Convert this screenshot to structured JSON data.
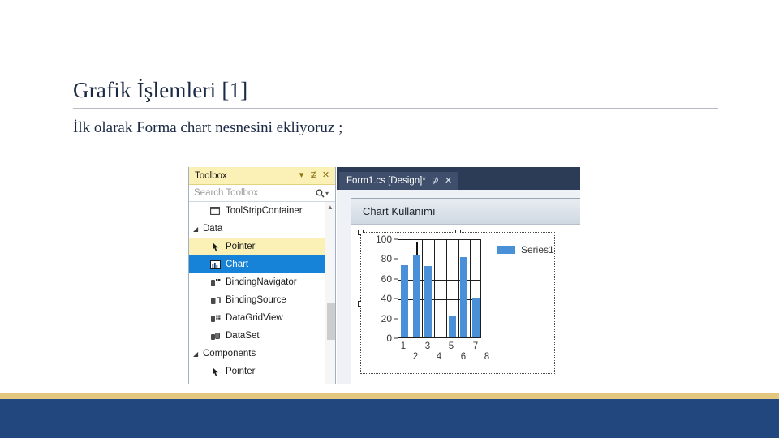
{
  "slide": {
    "title": "Grafik İşlemleri [1]",
    "subtitle": "İlk olarak Forma chart nesnesini ekliyoruz ;",
    "accent_gold": "#e3c77e",
    "accent_navy": "#22477f",
    "title_color": "#1b2a44"
  },
  "toolbox": {
    "title": "Toolbox",
    "header_icons": [
      {
        "name": "chevron-down-icon",
        "glyph": "▾"
      },
      {
        "name": "pin-icon",
        "glyph": "⊉"
      },
      {
        "name": "close-icon",
        "glyph": "✕"
      }
    ],
    "search": {
      "placeholder": "Search Toolbox",
      "magnifier_glyph": "⌕",
      "caret_glyph": "▾"
    },
    "items": [
      {
        "label": "ToolStripContainer",
        "icon": "toolstripcontainer-icon",
        "kind": "item",
        "state": "normal"
      },
      {
        "label": "Data",
        "icon": "expander-icon",
        "kind": "group",
        "state": "normal"
      },
      {
        "label": "Pointer",
        "icon": "pointer-icon",
        "kind": "item",
        "state": "hover"
      },
      {
        "label": "Chart",
        "icon": "chart-icon",
        "kind": "item",
        "state": "selected"
      },
      {
        "label": "BindingNavigator",
        "icon": "bindingnavigator-icon",
        "kind": "item",
        "state": "normal"
      },
      {
        "label": "BindingSource",
        "icon": "bindingsource-icon",
        "kind": "item",
        "state": "normal"
      },
      {
        "label": "DataGridView",
        "icon": "datagridview-icon",
        "kind": "item",
        "state": "normal"
      },
      {
        "label": "DataSet",
        "icon": "dataset-icon",
        "kind": "item",
        "state": "normal"
      },
      {
        "label": "Components",
        "icon": "expander-icon",
        "kind": "group",
        "state": "normal"
      },
      {
        "label": "Pointer",
        "icon": "pointer-icon",
        "kind": "item",
        "state": "normal"
      }
    ],
    "selected_color": "#1683d8",
    "hover_color": "#fbf0b6"
  },
  "editor": {
    "tab_label": "Form1.cs [Design]*",
    "tab_icons": [
      {
        "name": "pin-icon",
        "glyph": "⊉"
      },
      {
        "name": "close-icon",
        "glyph": "✕"
      }
    ],
    "form_caption": "Chart Kullanımı"
  },
  "chart_data": {
    "type": "bar",
    "title": "",
    "xlabel": "",
    "ylabel": "",
    "categories": [
      "1",
      "2",
      "3",
      "4",
      "5",
      "6",
      "7"
    ],
    "x_tick_labels_row1": [
      "1",
      "3",
      "5",
      "7"
    ],
    "x_tick_labels_row2": [
      "2",
      "4",
      "6",
      "8"
    ],
    "values": [
      73,
      84,
      72,
      0,
      22,
      81,
      40
    ],
    "series": [
      {
        "name": "Series1",
        "color": "#4a90d9",
        "values": [
          73,
          84,
          72,
          0,
          22,
          81,
          40
        ]
      }
    ],
    "ylim": [
      0,
      100
    ],
    "y_ticks": [
      0,
      20,
      40,
      60,
      80,
      100
    ],
    "grid": true,
    "legend": [
      "Series1"
    ],
    "legend_position": "right"
  }
}
